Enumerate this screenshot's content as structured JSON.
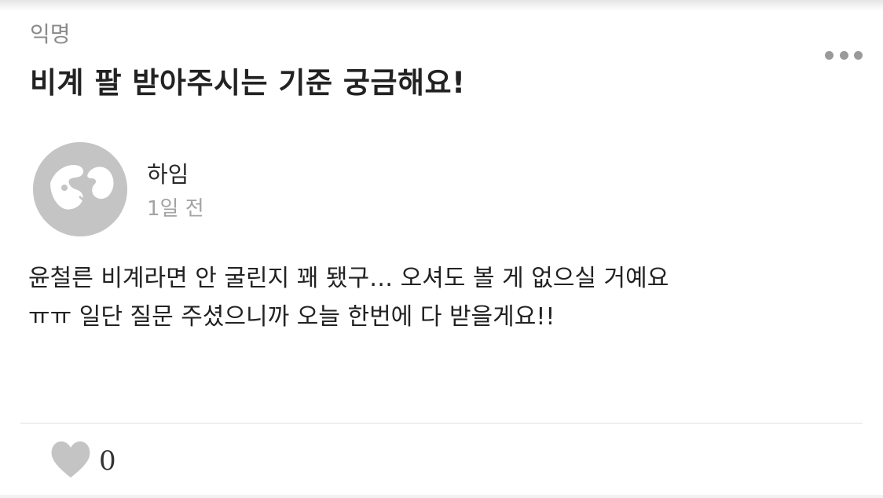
{
  "post": {
    "board_label": "익명",
    "title": "비계 팔 받아주시는 기준 궁금해요!",
    "more_icon": "more-horizontal-icon",
    "author": {
      "name": "하임",
      "time": "1일 전",
      "avatar_icon": "default-avatar-icon"
    },
    "body_lines": [
      "윤철른 비계라면 안 굴린지 꽤 됐구… 오셔도 볼 게 없으실 거예요",
      "ㅠㅠ 일단 질문 주셨으니까 오늘 한번에 다 받을게요!!"
    ]
  },
  "footer": {
    "like_icon": "heart-icon",
    "like_count": "0"
  },
  "colors": {
    "icon_gray": "#c4c4c4",
    "text_primary": "#222222",
    "text_secondary": "#8a8a8a"
  }
}
